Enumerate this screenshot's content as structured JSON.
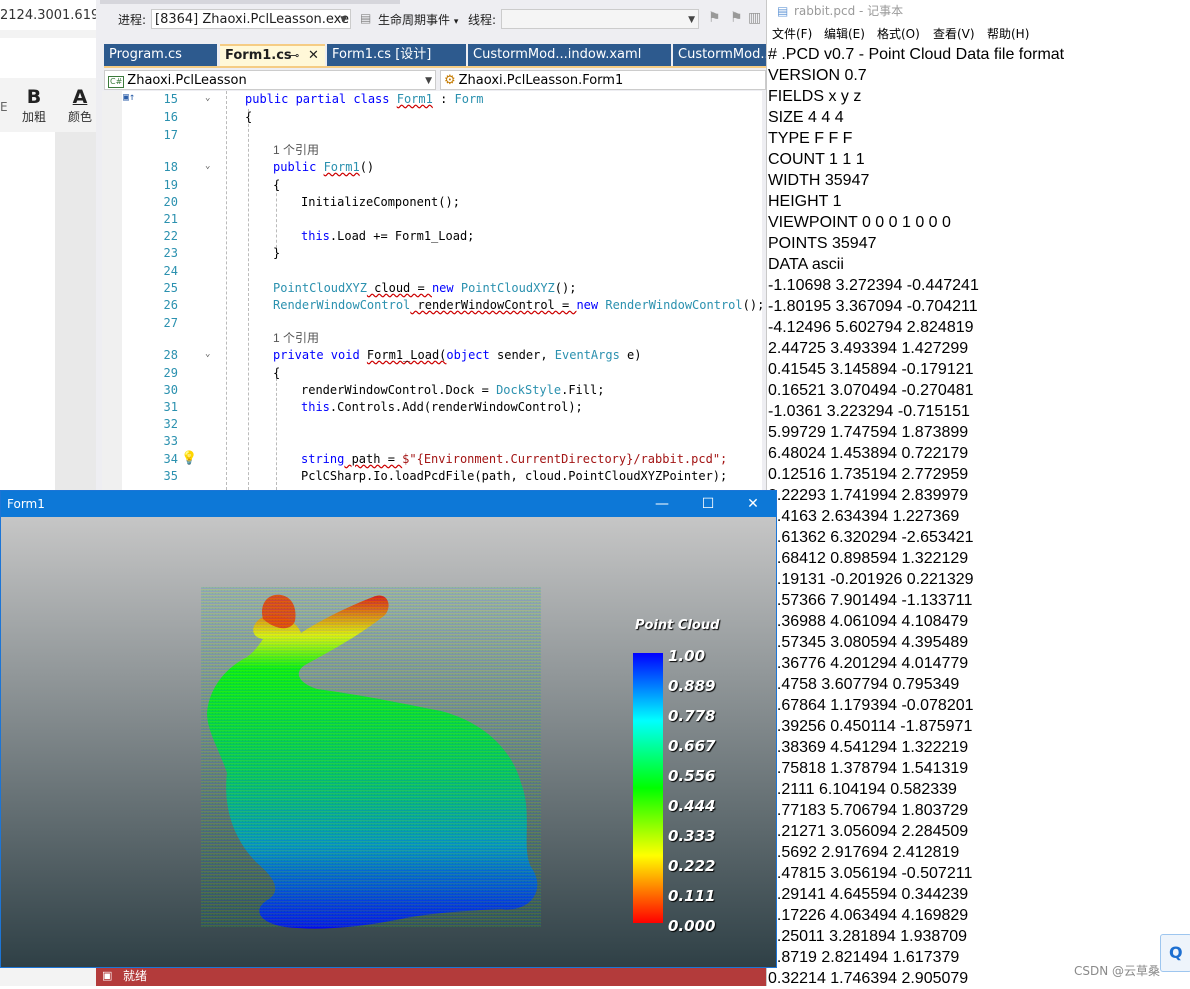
{
  "left_app": {
    "version_text": "2124.3001.619",
    "bold_label": "加粗",
    "color_label": "颜色",
    "bold_glyph": "B",
    "color_glyph": "A"
  },
  "vs": {
    "process_label": "进程:",
    "process_value": "[8364] Zhaoxi.PclLeasson.exe",
    "lifecycle_label": "生命周期事件",
    "thread_label": "线程:",
    "tabs": [
      {
        "label": "Program.cs"
      },
      {
        "label": "Form1.cs"
      },
      {
        "label": "Form1.cs [设计]"
      },
      {
        "label": "CustormMod...indow.xaml"
      },
      {
        "label": "CustormMod..."
      }
    ],
    "nav_left": "Zhaoxi.PclLeasson",
    "nav_right": "Zhaoxi.PclLeasson.Form1",
    "line_numbers": [
      "15",
      "16",
      "17",
      "18",
      "19",
      "20",
      "21",
      "22",
      "23",
      "24",
      "25",
      "26",
      "27",
      "28",
      "29",
      "30",
      "31",
      "32",
      "33",
      "34",
      "35"
    ],
    "ref_text": "1 个引用",
    "code": {
      "l15a": "public partial class ",
      "l15b": "Form1",
      "l15c": " : ",
      "l15d": "Form",
      "l16": "{",
      "l18a": "public ",
      "l18b": "Form1",
      "l18c": "()",
      "l19": "{",
      "l20": "InitializeComponent();",
      "l22a": "this",
      "l22b": ".Load += Form1_Load;",
      "l23": "}",
      "l25a": "PointCloudXYZ",
      "l25b": " cloud = ",
      "l25c": "new ",
      "l25d": "PointCloudXYZ",
      "l25e": "();",
      "l26a": "RenderWindowControl",
      "l26b": " renderWindowControl = ",
      "l26c": "new ",
      "l26d": "RenderWindowControl",
      "l26e": "();",
      "l28a": "private void ",
      "l28b": "Form1_Load(",
      "l28c": "object",
      "l28d": " sender, ",
      "l28e": "EventArgs",
      "l28f": " e)",
      "l29": "{",
      "l30a": "renderWindowControl.Dock = ",
      "l30b": "DockStyle",
      "l30c": ".Fill;",
      "l31a": "this",
      "l31b": ".Controls.Add(renderWindowControl);",
      "l34a": "string",
      "l34b": " path = ",
      "l34c": "$\"{Environment.CurrentDirectory}/rabbit.pcd\";",
      "l35": "PclCSharp.Io.loadPcdFile(path, cloud.PointCloudXYZPointer);"
    },
    "status": "就绪"
  },
  "notepad": {
    "title": "rabbit.pcd - 记事本",
    "menu": [
      "文件(F)",
      "编辑(E)",
      "格式(O)",
      "查看(V)",
      "帮助(H)"
    ],
    "lines": [
      "# .PCD v0.7 - Point Cloud Data file format",
      "VERSION 0.7",
      "FIELDS x y z",
      "SIZE 4 4 4",
      "TYPE F F F",
      "COUNT 1 1 1",
      "WIDTH 35947",
      "HEIGHT 1",
      "VIEWPOINT 0 0 0 1 0 0 0",
      "POINTS 35947",
      "DATA ascii",
      "-1.10698 3.272394 -0.447241",
      "-1.80195 3.367094 -0.704211",
      "-4.12496 5.602794 2.824819",
      "2.44725 3.493394 1.427299",
      "0.41545 3.145894 -0.179121",
      "0.16521 3.070494 -0.270481",
      "-1.0361 3.223294 -0.715151",
      "5.99729 1.747594 1.873899",
      "6.48024 1.453894 0.722179",
      "0.12516 1.735194 2.772959",
      "2.22293 1.741994 2.839979",
      "4.4163 2.634394 1.227369",
      "3.61362 6.320294 -2.653421",
      "6.68412 0.898594 1.322129",
      "1.19131 -0.201926 0.221329",
      "0.57366 7.901494 -1.133711",
      "5.36988 4.061094 4.108479",
      "4.57345 3.080594 4.395489",
      "5.36776 4.201294 4.014779",
      "4.4758 3.607794 0.795349",
      "6.67864 1.179394 -0.078201",
      "3.39256 0.450114 -1.875971",
      "5.38369 4.541294 1.322219",
      "5.75818 1.378794 1.541319",
      "4.2111 6.104194 0.582339",
      "5.77183 5.706794 1.803729",
      "3.21271 3.056094 2.284509",
      "3.5692 2.917694 2.412819",
      "0.47815 3.056194 -0.507211",
      "2.29141 4.645594 0.344239",
      "5.17226 4.063494 4.169829",
      "2.25011 3.281894 1.938709",
      "1.8719 2.821494 1.617379",
      "0.32214 1.746394 2.905079"
    ]
  },
  "form1": {
    "title": "Form1",
    "minimize": "—",
    "maximize": "☐",
    "close": "✕",
    "scalar_bar_title": "Point Cloud",
    "scalar_bar_labels": [
      "1.00",
      "0.889",
      "0.778",
      "0.667",
      "0.556",
      "0.444",
      "0.333",
      "0.222",
      "0.111",
      "0.000"
    ],
    "scalar_bar_colors": [
      "#0000ff",
      "#00ffff",
      "#00ff00",
      "#ffff00",
      "#ff0000"
    ]
  },
  "watermark": "CSDN @云草桑"
}
